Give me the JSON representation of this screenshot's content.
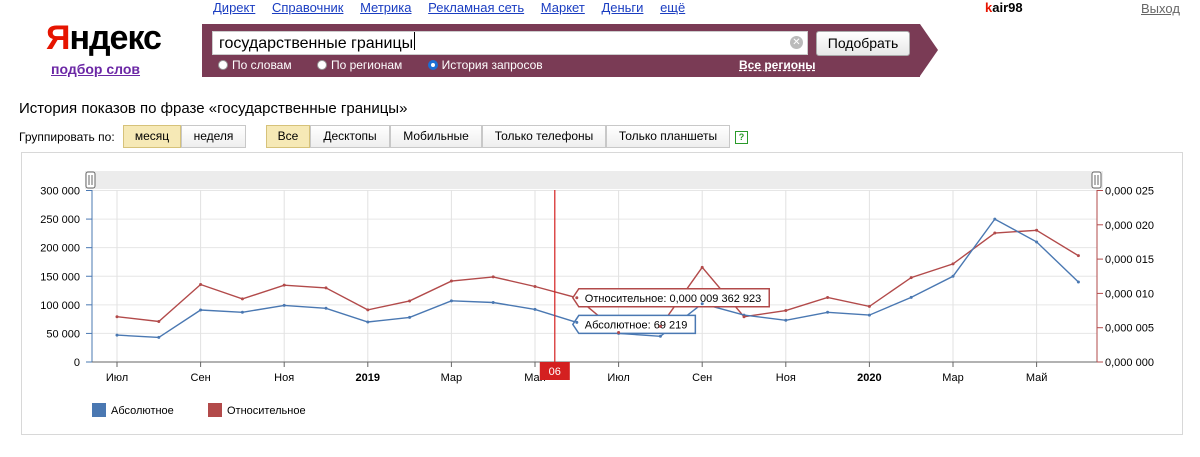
{
  "logo": {
    "first_letter": "Я",
    "rest": "ндекс",
    "subtitle": "подбор слов"
  },
  "topnav": [
    "Директ",
    "Справочник",
    "Метрика",
    "Рекламная сеть",
    "Маркет",
    "Деньги",
    "ещё"
  ],
  "user": {
    "first_letter": "k",
    "rest": "air98",
    "logout": "Выход"
  },
  "search": {
    "query": "государственные границы",
    "button": "Подобрать",
    "modes": [
      {
        "label": "По словам",
        "selected": false
      },
      {
        "label": "По регионам",
        "selected": false
      },
      {
        "label": "История запросов",
        "selected": true
      }
    ],
    "regions": "Все регионы"
  },
  "page_title": "История показов по фразе «государственные границы»",
  "grouping": {
    "label": "Группировать по:",
    "options": [
      {
        "label": "месяц",
        "selected": true
      },
      {
        "label": "неделя",
        "selected": false
      }
    ]
  },
  "devices": [
    {
      "label": "Все",
      "selected": true
    },
    {
      "label": "Десктопы",
      "selected": false
    },
    {
      "label": "Мобильные",
      "selected": false
    },
    {
      "label": "Только телефоны",
      "selected": false
    },
    {
      "label": "Только планшеты",
      "selected": false
    }
  ],
  "help": "?",
  "colors": {
    "absolute": "#4a78b2",
    "relative": "#b24a4a",
    "cursor": "#d42020",
    "searchband": "#7a3b55"
  },
  "chart_data": {
    "type": "line",
    "categories": [
      "2018-07",
      "2018-08",
      "2018-09",
      "2018-10",
      "2018-11",
      "2018-12",
      "2019-01",
      "2019-02",
      "2019-03",
      "2019-04",
      "2019-05",
      "2019-06",
      "2019-07",
      "2019-08",
      "2019-09",
      "2019-10",
      "2019-11",
      "2019-12",
      "2020-01",
      "2020-02",
      "2020-03",
      "2020-04",
      "2020-05",
      "2020-06"
    ],
    "x_tick_labels": [
      "Июл",
      "Сен",
      "Ноя",
      "2019",
      "Мар",
      "Май",
      "Июл",
      "Сен",
      "Ноя",
      "2020",
      "Мар",
      "Май"
    ],
    "x_tick_bold": [
      false,
      false,
      false,
      true,
      false,
      false,
      false,
      false,
      false,
      true,
      false,
      false
    ],
    "series": [
      {
        "name": "Абсолютное",
        "axis": "left",
        "values": [
          47000,
          43000,
          91000,
          87000,
          99000,
          94000,
          70000,
          78000,
          107000,
          104000,
          92000,
          69219,
          50000,
          45000,
          102000,
          82000,
          73000,
          87000,
          82000,
          113000,
          150000,
          250000,
          210000,
          140000
        ]
      },
      {
        "name": "Относительное",
        "axis": "right",
        "values": [
          0.0066,
          0.0059,
          0.0113,
          0.0092,
          0.0112,
          0.0108,
          0.0076,
          0.0089,
          0.0118,
          0.0124,
          0.011,
          0.009362923,
          0.0043,
          0.0052,
          0.0138,
          0.0066,
          0.0075,
          0.0094,
          0.0081,
          0.0123,
          0.0143,
          0.0188,
          0.0192,
          0.0155
        ]
      }
    ],
    "y_left": {
      "ylim": [
        0,
        300000
      ],
      "ticks": [
        "0",
        "50 000",
        "100 000",
        "150 000",
        "200 000",
        "250 000",
        "300 000"
      ]
    },
    "y_right": {
      "ylim": [
        0,
        0.025
      ],
      "ticks": [
        "0,000 000",
        "0,000 005",
        "0,000 010",
        "0,000 015",
        "0,000 020",
        "0,000 025"
      ]
    },
    "cursor": {
      "index": 11,
      "label": "06"
    },
    "tooltip_relative": "Относительное: 0,000 009 362 923",
    "tooltip_absolute": "Абсолютное: 69 219",
    "legend": [
      {
        "name": "Абсолютное",
        "color": "#4a78b2"
      },
      {
        "name": "Относительное",
        "color": "#b24a4a"
      }
    ],
    "legend_position": "bottom-left",
    "grid": true
  }
}
